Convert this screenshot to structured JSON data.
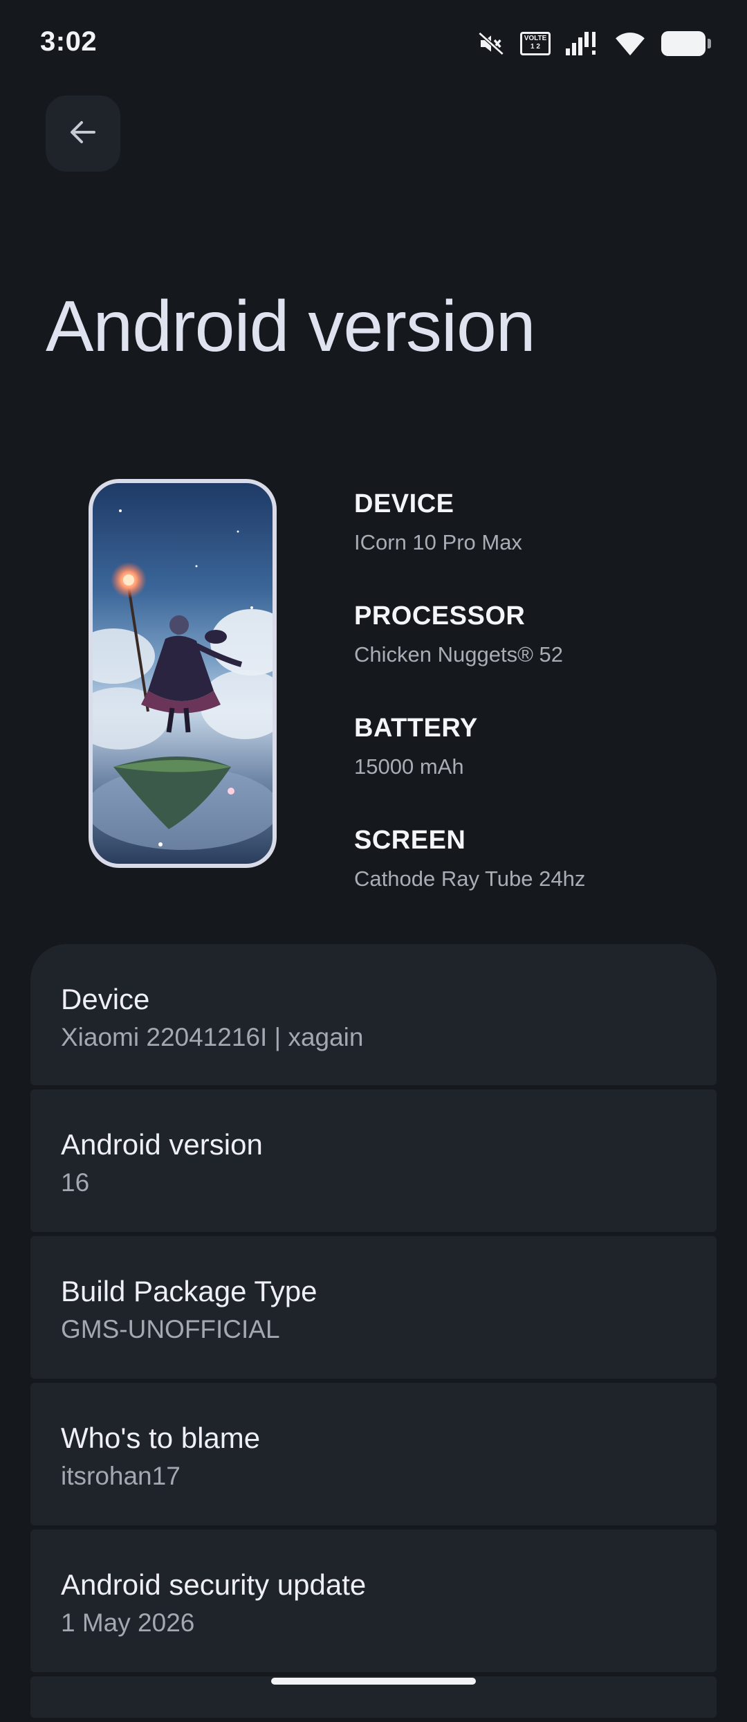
{
  "status_bar": {
    "time": "3:02",
    "volte_top": "VOLTE",
    "volte_bottom": "1 2",
    "icons": [
      "mute-icon",
      "volte-icon",
      "signal-icon",
      "wifi-icon",
      "battery-icon"
    ]
  },
  "header": {
    "back_icon": "arrow-back-icon",
    "title": "Android version"
  },
  "specs": [
    {
      "label": "DEVICE",
      "value": "ICorn 10 Pro Max"
    },
    {
      "label": "PROCESSOR",
      "value": "Chicken Nuggets® 52"
    },
    {
      "label": "BATTERY",
      "value": "15000 mAh"
    },
    {
      "label": "SCREEN",
      "value": "Cathode Ray Tube 24hz"
    }
  ],
  "info_items": [
    {
      "title": "Device",
      "value": "Xiaomi 22041216I | xagain"
    },
    {
      "title": "Android version",
      "value": "16"
    },
    {
      "title": "Build Package Type",
      "value": "GMS-UNOFFICIAL"
    },
    {
      "title": "Who's to blame",
      "value": "itsrohan17"
    },
    {
      "title": "Android security update",
      "value": "1 May 2026"
    }
  ],
  "colors": {
    "background": "#15181c",
    "card": "#1f232a",
    "title": "#dfe3ef",
    "secondary_text": "#a4a8b1"
  }
}
